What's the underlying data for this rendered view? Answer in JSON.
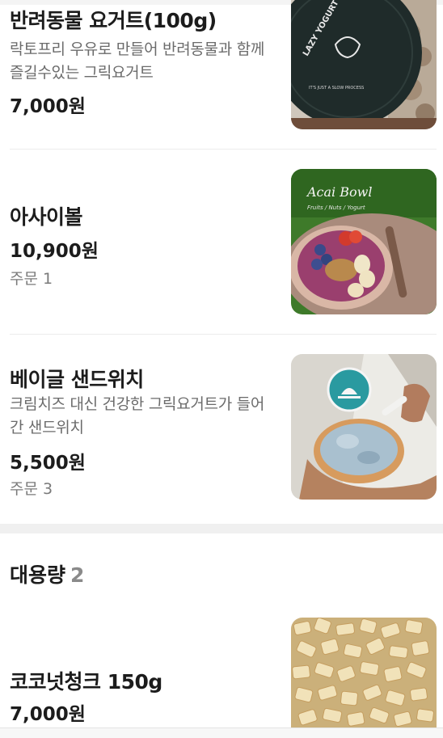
{
  "menu_items": [
    {
      "name": "반려동물 요거트(100g)",
      "description": "락토프리 우유로 만들어 반려동물과 함께 즐길수있는 그릭요거트",
      "price": "7,000원",
      "image_text": "LAZY YOGURT",
      "image_subtext": "IT'S JUST A SLOW PROCESS"
    },
    {
      "name": "아사이볼",
      "price": "10,900원",
      "orders": "주문 1",
      "image_text": "Acai Bowl",
      "image_subtext": "Fruits / Nuts / Yogurt"
    },
    {
      "name": "베이글 샌드위치",
      "description": "크림치즈 대신 건강한 그릭요거트가 들어간 샌드위치",
      "price": "5,500원",
      "orders": "주문 3"
    },
    {
      "name": "코코넛청크 150g",
      "price": "7,000원"
    }
  ],
  "section": {
    "title": "대용량",
    "count": "2"
  },
  "colors": {
    "text": "#1c1c1c",
    "muted": "#6b6b6b",
    "divider": "#ececec",
    "section_gap": "#f0f0f0"
  }
}
